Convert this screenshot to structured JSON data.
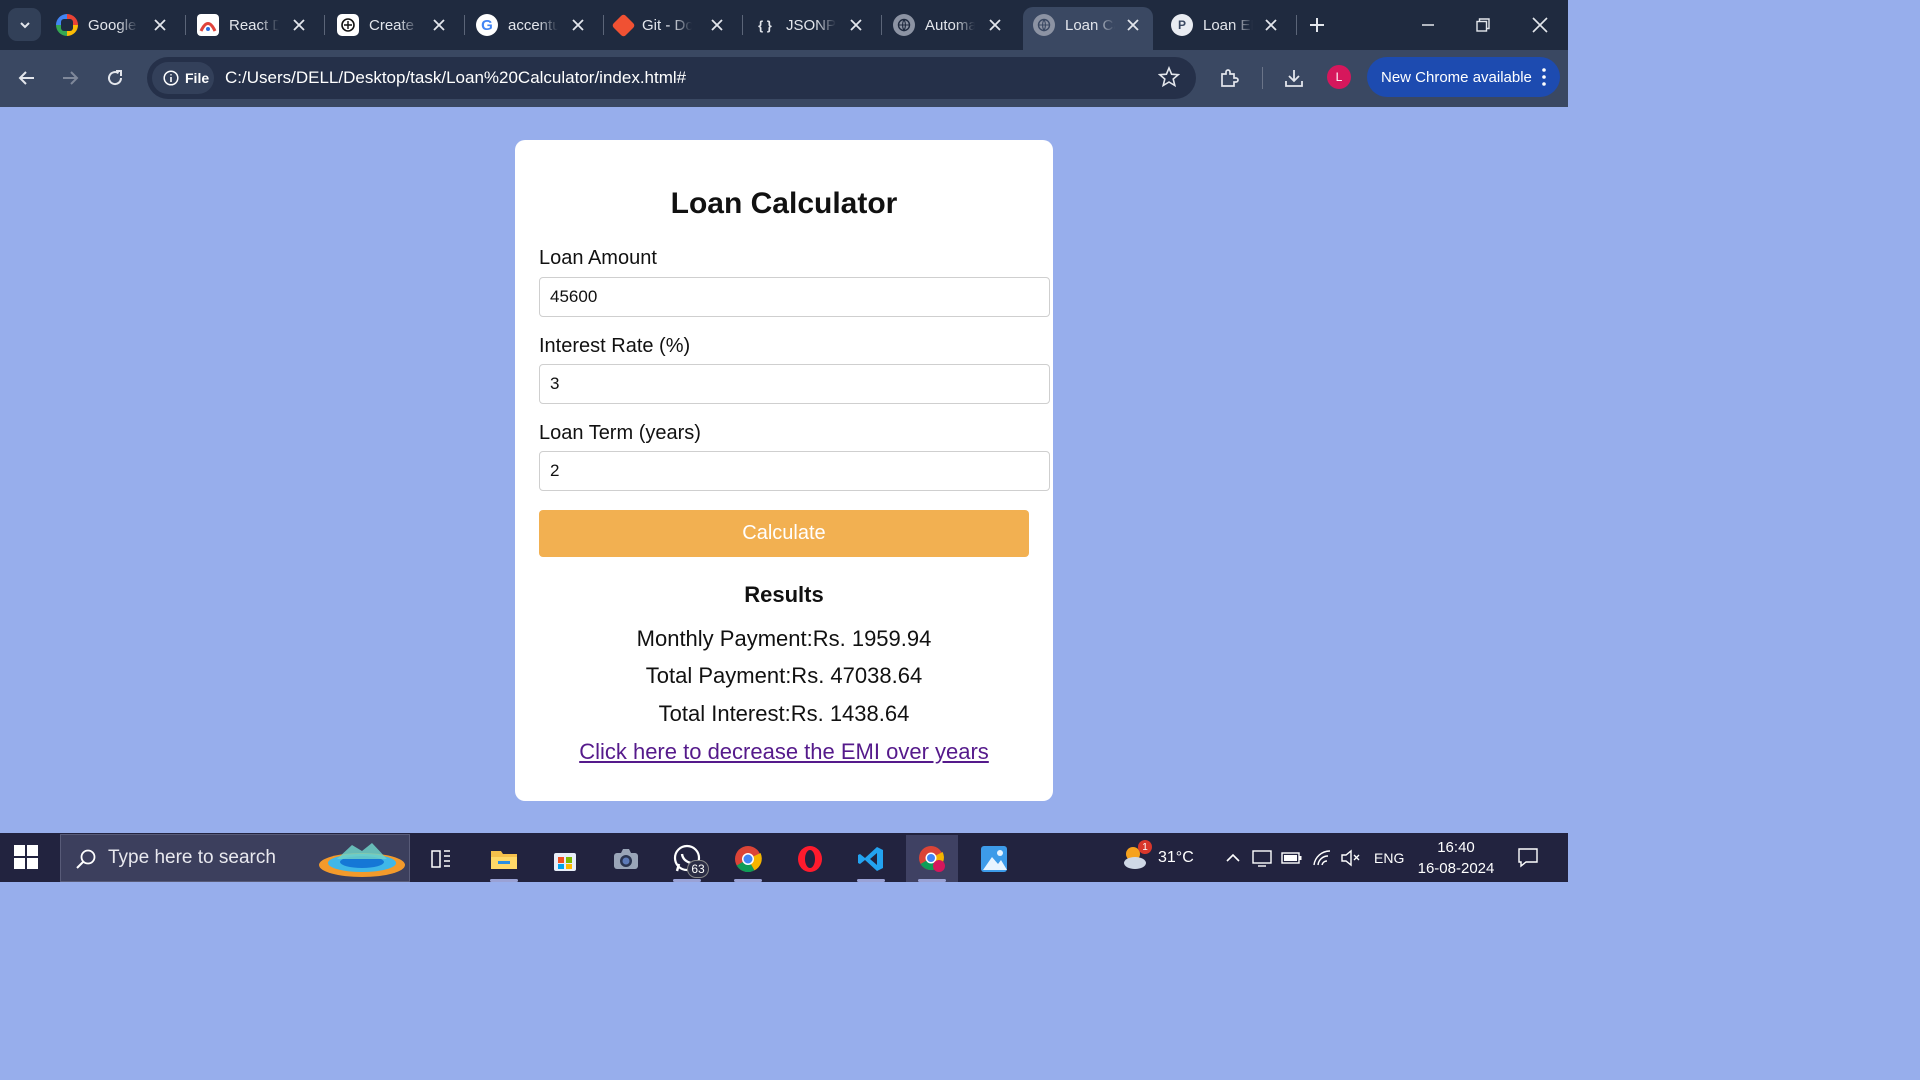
{
  "browser": {
    "tabs": [
      {
        "title": "Google",
        "favicon": "google-workspace-icon",
        "active": false
      },
      {
        "title": "React D",
        "favicon": "react-docs-icon",
        "active": false
      },
      {
        "title": "Create N",
        "favicon": "chatgpt-icon",
        "active": false
      },
      {
        "title": "accentu",
        "favicon": "google-g-icon",
        "active": false
      },
      {
        "title": "Git - Do",
        "favicon": "git-icon",
        "active": false
      },
      {
        "title": "JSONPla",
        "favicon": "jsonplaceholder-icon",
        "active": false
      },
      {
        "title": "Automa",
        "favicon": "globe-icon",
        "active": false
      },
      {
        "title": "Loan Ca",
        "favicon": "globe-icon",
        "active": true
      },
      {
        "title": "Loan EM",
        "favicon": "p-icon",
        "active": false
      }
    ],
    "site_chip": "File",
    "url": "C:/Users/DELL/Desktop/task/Loan%20Calculator/index.html#",
    "profile_initial": "L",
    "update_label": "New Chrome available",
    "colors": {
      "frame": "#1f2a3f",
      "toolbar": "#3a4862",
      "update": "#1d4bb0",
      "profile": "#d6175c"
    }
  },
  "page": {
    "background": "#97aeec",
    "title": "Loan Calculator",
    "fields": {
      "amount": {
        "label": "Loan Amount",
        "value": "45600"
      },
      "rate": {
        "label": "Interest Rate (%)",
        "value": "3"
      },
      "term": {
        "label": "Loan Term (years)",
        "value": "2"
      }
    },
    "calculate_label": "Calculate",
    "button_color": "#f2b051",
    "results": {
      "heading": "Results",
      "monthly": "Monthly Payment:Rs. 1959.94",
      "total": "Total Payment:Rs. 47038.64",
      "interest": "Total Interest:Rs. 1438.64"
    },
    "emi_link": "Click here to decrease the EMI over years"
  },
  "taskbar": {
    "search_placeholder": "Type here to search",
    "apps": [
      "task-view-icon",
      "file-explorer-icon",
      "microsoft-store-icon",
      "camera-icon",
      "whatsapp-icon",
      "chrome-icon",
      "opera-icon",
      "vscode-icon",
      "chrome-profile-icon",
      "photos-icon"
    ],
    "whatsapp_badge": "63",
    "weather_badge": "1",
    "temperature": "31°C",
    "language": "ENG",
    "time": "16:40",
    "date": "16-08-2024"
  }
}
